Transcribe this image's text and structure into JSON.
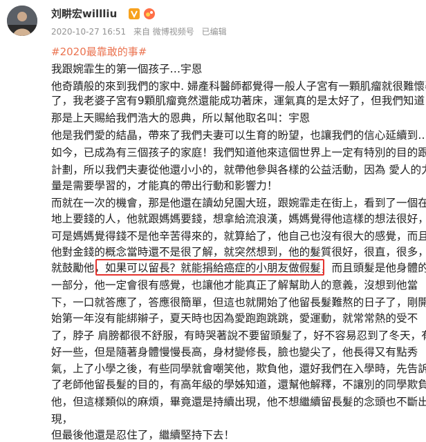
{
  "header": {
    "username": "刘畊宏willliu",
    "verified_badge_icon": "verified-v-icon",
    "vip_badge_icon": "vip-badge-icon",
    "timestamp": "2020-10-27 16:51",
    "source": "来自 微博视频号",
    "edited": "已编辑"
  },
  "hashtag": "#2020最靠敢的事#",
  "paragraph_lines": [
    "我跟婉霏生的第一個孩子…宇恩",
    "他奇蹟般的來到我們的家中. 婦產科醫師都覺得一般人子宮有一顆肌瘤就很難懷孕",
    "了，我老婆子宮有9顆肌瘤竟然還能成功著床，運氣真的是太好了，但我們知道，",
    "那是上天賜給我們浩大的恩典，所以幫他取名叫：宇恩",
    "他是我們愛的結晶，帶來了我們夫妻可以生育的盼望，也讓我們的信心延續到…",
    "如今，已成為有三個孩子的家庭！我們知道他來這個世界上一定有特別的目的跟",
    "計劃，所以我們夫妻從他還小小的，就帶他參與各樣的公益活動，因為 愛人的力",
    "量是需要學習的，才能真的帶出行動和影響力！",
    "而就在一次的機會，那是他還在讀幼兒園大班，跟婉霏走在街上，看到了一個在",
    "地上要錢的人，他就跟媽媽要錢，想拿給流浪漢，媽媽覺得他這樣的想法很好，",
    "可是媽媽覺得錢不是他辛苦得來的，就算給了，他自己也沒有很大的感覺，而且",
    "他對金錢的概念當時還不是很了解，就突然想到，他的髮質很好，很直，很多，",
    "就鼓勵他，如果可以留長？就能捐給癌症的小朋友做假髮，而且頭髮是他身體的",
    "一部分，他一定會很有感覺，也讓他才能真正了解幫助人的意義，沒想到他當",
    "下，一口就答應了，答應很簡單，但這也就開始了他留長髮難熬的日子了，剛開",
    "始第一年沒有能綁辮子，夏天時也因為愛跑跑跳跳，愛運動，就常常熱的受不",
    "了，脖子 肩膀都很不舒服，有時哭著說不要留頭髮了，好不容易忍到了冬天，有",
    "好一些，但是隨著身體慢慢長高，身材變修長，臉也變尖了，他長得又有點秀",
    "氣，上了小學之後，有些同學就會嘲笑他，欺負他，還好我們在入學時，先告訴",
    "了老師他留長髮的目的，有高年級的學姊知道，還幫他解釋，不讓別的同學欺負",
    "他，但這樣類似的麻煩，畢竟還是持續出現，他不想繼續留長髮的念頭也不斷出",
    "現，",
    "但最後他還是忍住了，繼續堅持下去！"
  ],
  "highlighted_text": "如果可以留長？就能捐給癌症的小朋友做假髮",
  "colors": {
    "hashtag": "#eb7350",
    "meta": "#939393",
    "highlight_box": "#e5322d",
    "verified_badge": "#f7a21e"
  }
}
